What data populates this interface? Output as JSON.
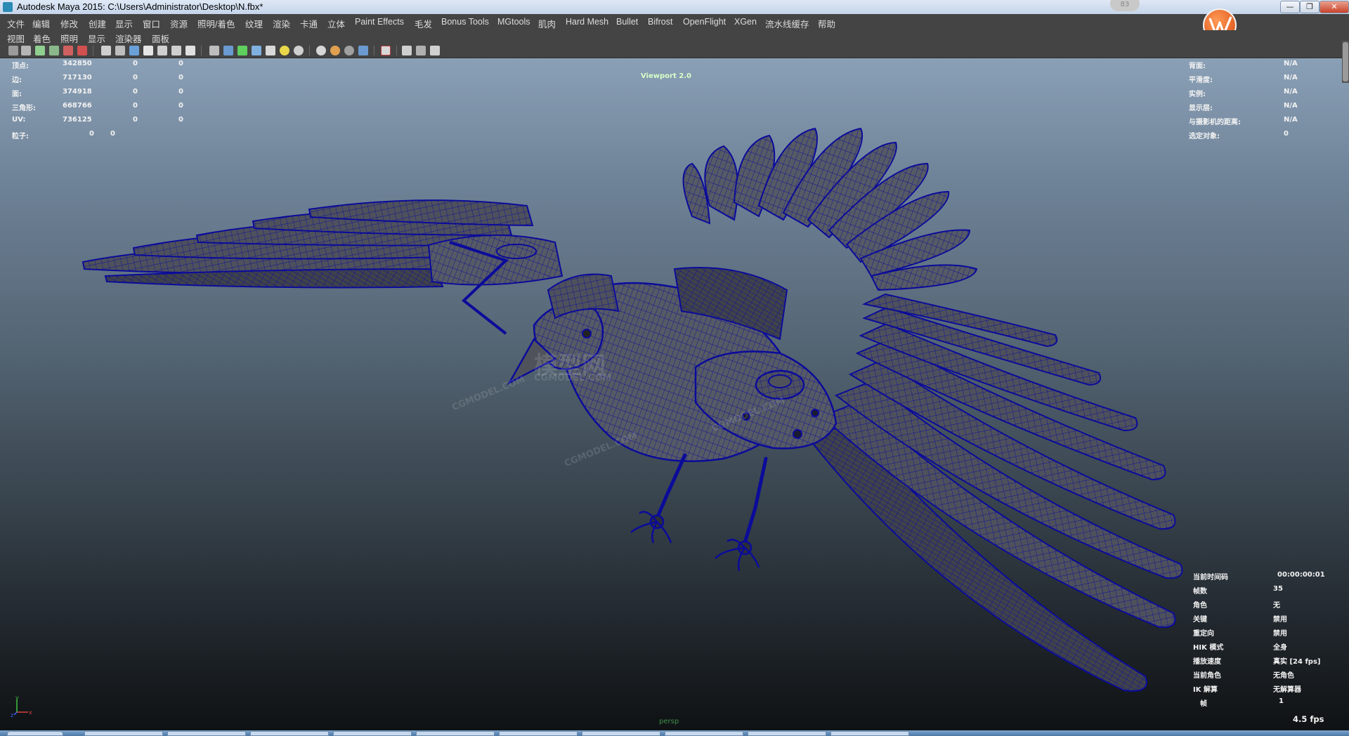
{
  "window": {
    "title": "Autodesk Maya 2015: C:\\Users\\Administrator\\Desktop\\N.fbx*",
    "badge": "83",
    "controls": {
      "minimize": "—",
      "restore": "❐",
      "close": "✕"
    }
  },
  "menubar": [
    "文件",
    "编辑",
    "修改",
    "创建",
    "显示",
    "窗口",
    "资源",
    "照明/着色",
    "纹理",
    "渲染",
    "卡通",
    "立体",
    "Paint Effects",
    "毛发",
    "Bonus Tools",
    "MGtools",
    "肌肉",
    "Hard Mesh",
    "Bullet",
    "Bifrost",
    "OpenFlight",
    "XGen",
    "流水线缓存",
    "帮助"
  ],
  "panel_menu": [
    "视图",
    "着色",
    "照明",
    "显示",
    "渲染器",
    "面板"
  ],
  "viewport": {
    "renderer_label": "Viewport 2.0",
    "camera_label": "persp",
    "fps": "4.5 fps",
    "stats_left": [
      {
        "label": "顶点:",
        "v1": "342850",
        "v2": "0",
        "v3": "0"
      },
      {
        "label": "边:",
        "v1": "717130",
        "v2": "0",
        "v3": "0"
      },
      {
        "label": "面:",
        "v1": "374918",
        "v2": "0",
        "v3": "0"
      },
      {
        "label": "三角形:",
        "v1": "668766",
        "v2": "0",
        "v3": "0"
      },
      {
        "label": "UV:",
        "v1": "736125",
        "v2": "0",
        "v3": "0"
      }
    ],
    "particles": {
      "label": "粒子:",
      "v1": "0",
      "v2": "0"
    },
    "stats_right": [
      {
        "label": "背面:",
        "value": "N/A"
      },
      {
        "label": "平滑度:",
        "value": "N/A"
      },
      {
        "label": "实例:",
        "value": "N/A"
      },
      {
        "label": "显示层:",
        "value": "N/A"
      },
      {
        "label": "与摄影机的距离:",
        "value": "N/A"
      },
      {
        "label": "选定对象:",
        "value": "0"
      }
    ],
    "hud_bottom_right": [
      {
        "label": "当前时间码",
        "value": "00:00:00:01"
      },
      {
        "label": "帧数",
        "value": "35"
      },
      {
        "label": "角色",
        "value": "无"
      },
      {
        "label": "关键",
        "value": "禁用"
      },
      {
        "label": "重定向",
        "value": "禁用"
      },
      {
        "label": "HIK 模式",
        "value": "全身"
      },
      {
        "label": "播放速度",
        "value": "真实 [24 fps]"
      },
      {
        "label": "当前角色",
        "value": "无角色"
      },
      {
        "label": "IK 解算",
        "value": "无解算器"
      },
      {
        "label": "帧",
        "value": "1"
      }
    ],
    "axis": {
      "x": "x",
      "y": "y",
      "z": "z"
    },
    "watermarks": [
      "CGMODEL.COM",
      "模型网",
      "CGMODEL.COM",
      "CGMODEL.COM",
      "CGMODEL.COM"
    ]
  },
  "colors": {
    "wire": "#0b0b9a",
    "surface": "#4b4e57",
    "hud_text": "#f2f2f2",
    "hud_dim": "#3f8a3f",
    "menu_bg": "#444444"
  }
}
